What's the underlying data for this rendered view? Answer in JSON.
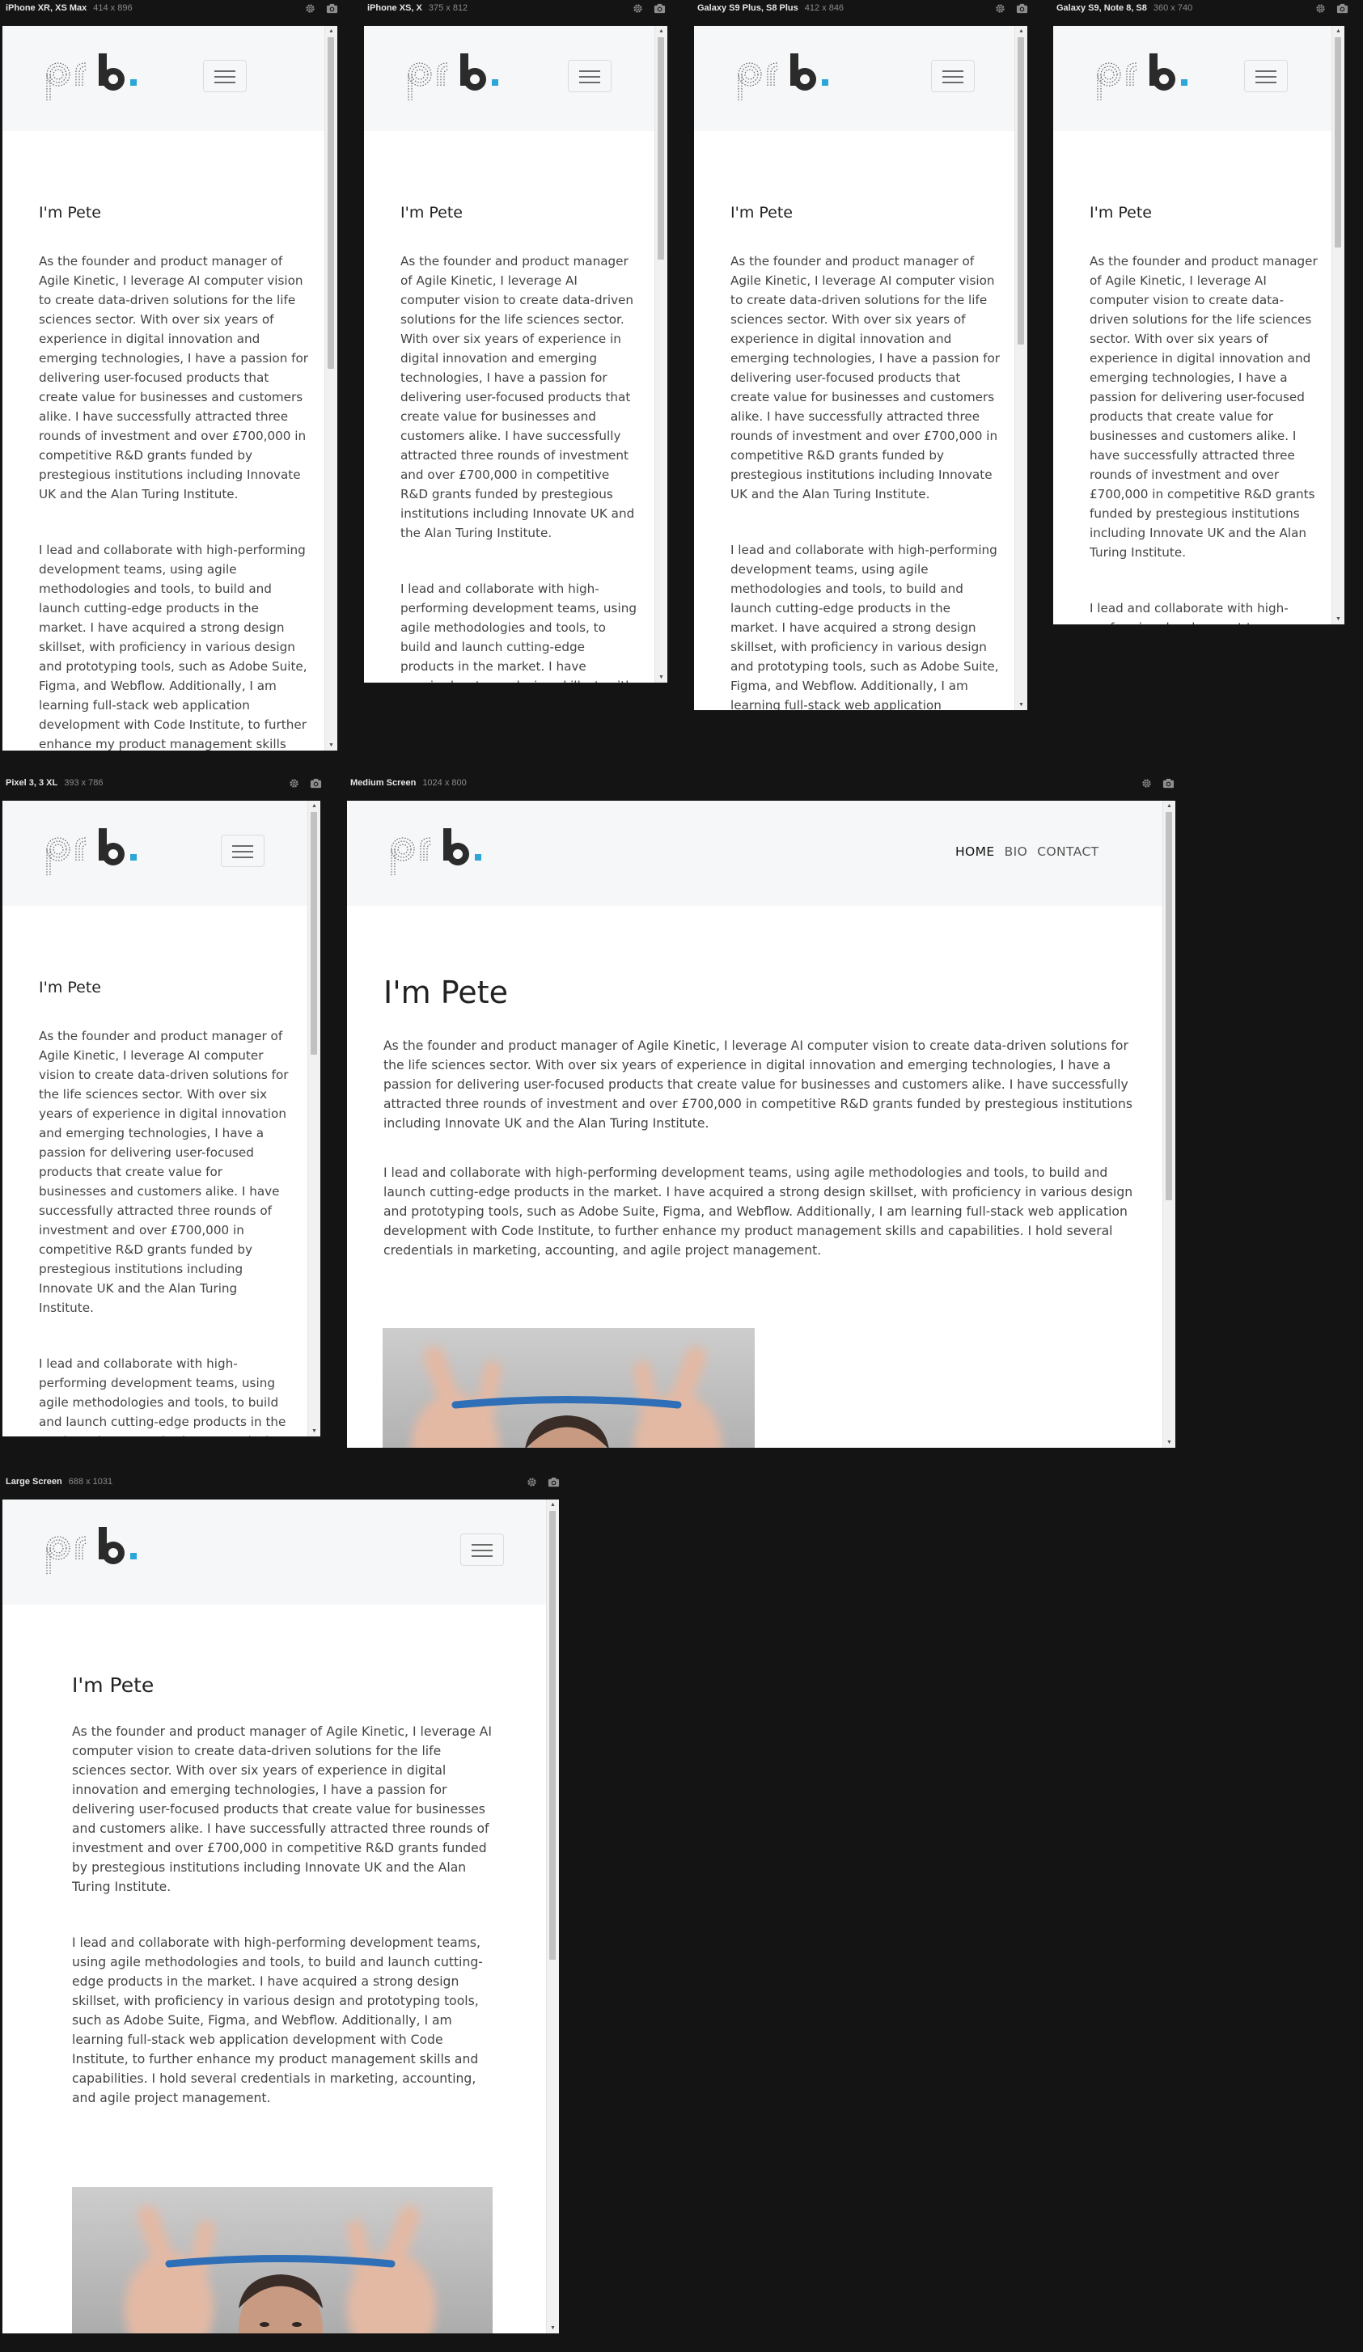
{
  "frames": [
    {
      "key": "f1",
      "name": "iPhone XR, XS Max",
      "dims": "414 x 896"
    },
    {
      "key": "f2",
      "name": "iPhone XS, X",
      "dims": "375 x 812"
    },
    {
      "key": "f3",
      "name": "Galaxy S9 Plus, S8 Plus",
      "dims": "412 x 846"
    },
    {
      "key": "f4",
      "name": "Galaxy S9, Note 8, S8",
      "dims": "360 x 740"
    },
    {
      "key": "f5",
      "name": "Pixel 3, 3 XL",
      "dims": "393 x 786"
    },
    {
      "key": "f6",
      "name": "Medium Screen",
      "dims": "1024 x 800"
    },
    {
      "key": "f7",
      "name": "Large Screen",
      "dims": "688 x 1031"
    }
  ],
  "site": {
    "logo_text": "prb.",
    "nav": {
      "home": "HOME",
      "bio": "BIO",
      "contact": "CONTACT"
    },
    "heading": "I'm Pete",
    "para1": "As the founder and product manager of Agile Kinetic, I leverage AI computer vision to create data-driven solutions for the life sciences sector. With over six years of experience in digital innovation and emerging technologies, I have a passion for delivering user-focused products that create value for businesses and customers alike. I have successfully attracted three rounds of investment and over £700,000 in competitive R&D grants funded by prestegious institutions including Innovate UK and the Alan Turing Institute.",
    "para2": "I lead and collaborate with high-performing development teams, using agile methodologies and tools, to build and launch cutting-edge products in the market. I have acquired a strong design skillset, with proficiency in various design and prototyping tools, such as Adobe Suite, Figma, and Webflow. Additionally, I am learning full-stack web application development with Code Institute, to further enhance my product management skills and capabilities. I hold several credentials in marketing, accounting, and agile project management."
  },
  "colors": {
    "accent": "#2ba6d6",
    "logo_dark": "#2b2b2b",
    "header_bg": "#f6f7f8",
    "canvas": "#141414"
  },
  "icons": {
    "settings": "gear-icon",
    "screenshot": "camera-icon",
    "menu": "hamburger-icon"
  }
}
